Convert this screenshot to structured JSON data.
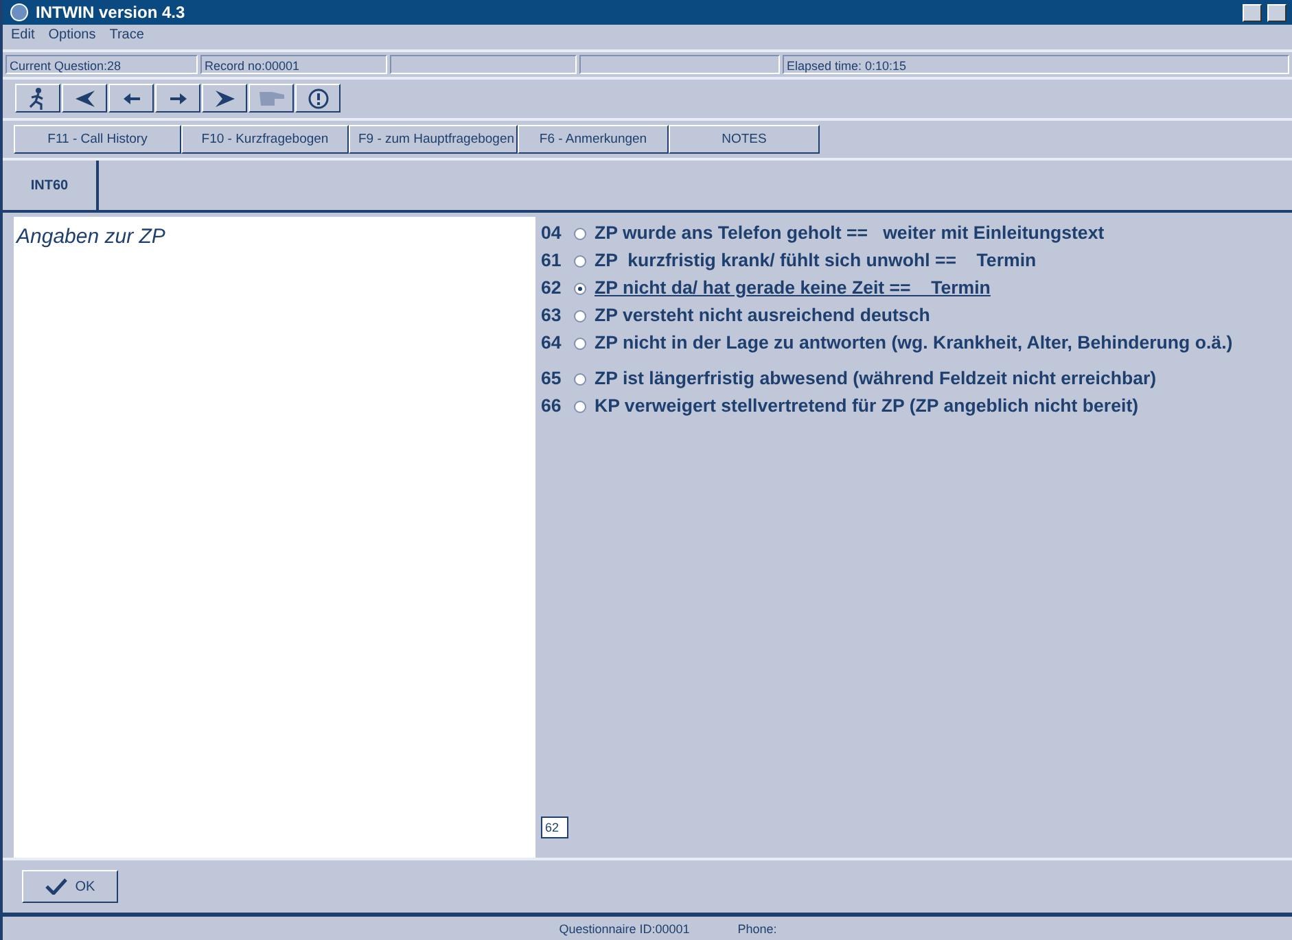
{
  "window": {
    "title": "INTWIN version 4.3"
  },
  "menu": [
    "Edit",
    "Options",
    "Trace"
  ],
  "info_bar": {
    "current_question": "Current Question:28",
    "record": "Record no:00001",
    "elapsed": "Elapsed time: 0:10:15"
  },
  "function_buttons": [
    "F11 - Call History",
    "F10 - Kurzfragebogen",
    "F9 - zum Hauptfragebogen",
    "F6 - Anmerkungen",
    "NOTES"
  ],
  "question_id": "INT60",
  "question_text": "Angaben zur ZP",
  "options": [
    {
      "code": "04",
      "text": "ZP wurde ans Telefon geholt ==   weiter mit Einleitungstext",
      "selected": false
    },
    {
      "code": "61",
      "text": "ZP  kurzfristig krank/ fühlt sich unwohl ==    Termin",
      "selected": false
    },
    {
      "code": "62",
      "text": "ZP nicht da/ hat gerade keine Zeit ==    Termin",
      "selected": true
    },
    {
      "code": "63",
      "text": "ZP versteht nicht ausreichend deutsch",
      "selected": false
    },
    {
      "code": "64",
      "text": "ZP nicht in der Lage zu antworten (wg. Krankheit, Alter, Behinderung o.ä.)",
      "selected": false
    },
    {
      "code": "65",
      "text": "ZP ist längerfristig abwesend (während Feldzeit nicht erreichbar)",
      "selected": false
    },
    {
      "code": "66",
      "text": "KP verweigert stellvertretend für ZP (ZP angeblich nicht bereit)",
      "selected": false
    }
  ],
  "answer": {
    "value": "62"
  },
  "ok_button": "OK",
  "status_bar": {
    "questionnaire": "Questionnaire ID:00001",
    "phone": "Phone:"
  }
}
